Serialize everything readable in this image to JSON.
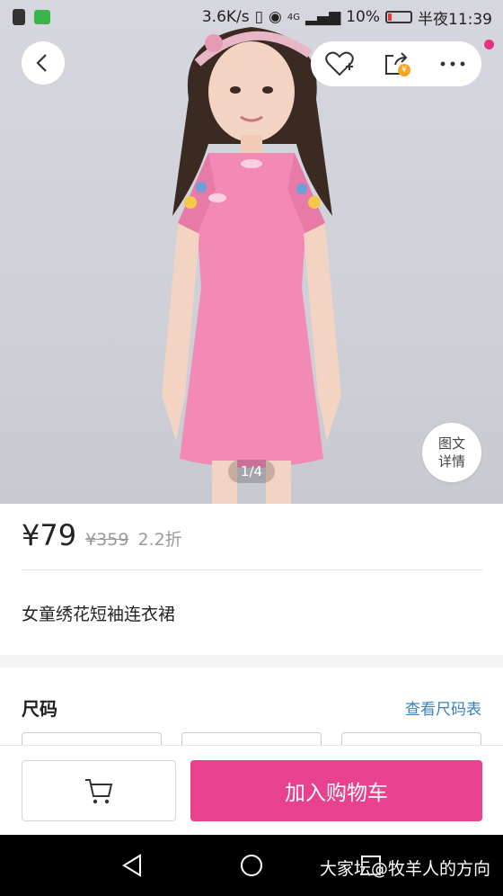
{
  "status_bar": {
    "speed": "3.6K/s",
    "network": "4G",
    "battery": "10%",
    "time": "半夜11:39"
  },
  "gallery": {
    "pager": "1/4",
    "detail_label_1": "图文",
    "detail_label_2": "详情"
  },
  "product": {
    "price": "¥79",
    "original_price": "¥359",
    "discount": "2.2折",
    "title": "女童绣花短袖连衣裙"
  },
  "size": {
    "label": "尺码",
    "chart_link": "查看尺码表"
  },
  "actions": {
    "add_to_cart": "加入购物车"
  },
  "watermark": "大家坛@牧羊人的方向",
  "colors": {
    "accent": "#e8418f",
    "link": "#3a7fc0"
  }
}
